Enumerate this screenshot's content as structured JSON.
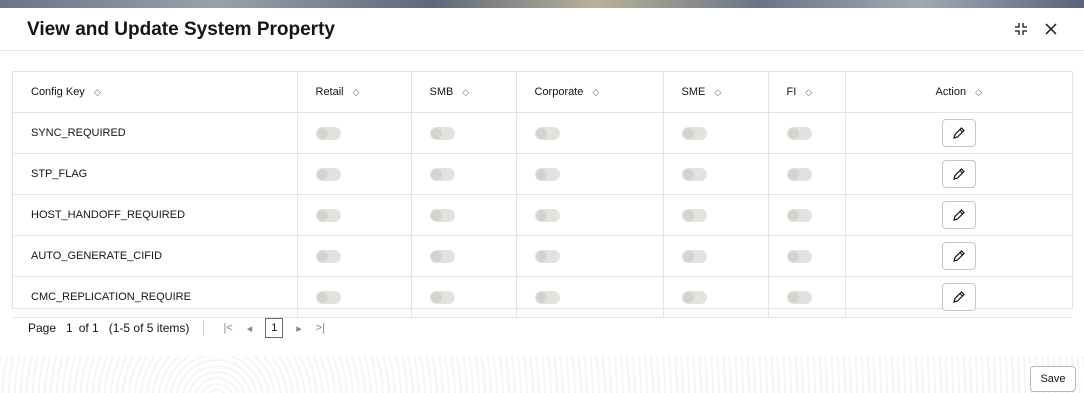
{
  "dialog": {
    "title": "View and Update System Property"
  },
  "table": {
    "columns": [
      {
        "label": "Config Key"
      },
      {
        "label": "Retail"
      },
      {
        "label": "SMB"
      },
      {
        "label": "Corporate"
      },
      {
        "label": "SME"
      },
      {
        "label": "FI"
      },
      {
        "label": "Action"
      }
    ],
    "rows": [
      {
        "key": "SYNC_REQUIRED"
      },
      {
        "key": "STP_FLAG"
      },
      {
        "key": "HOST_HANDOFF_REQUIRED"
      },
      {
        "key": "AUTO_GENERATE_CIFID"
      },
      {
        "key": "CMC_REPLICATION_REQUIRE"
      }
    ]
  },
  "pager": {
    "page_label": "Page",
    "current": "1",
    "of_label": "of 1",
    "range": "(1-5 of 5 items)",
    "page_button": "1"
  },
  "footer": {
    "save_label": "Save"
  }
}
